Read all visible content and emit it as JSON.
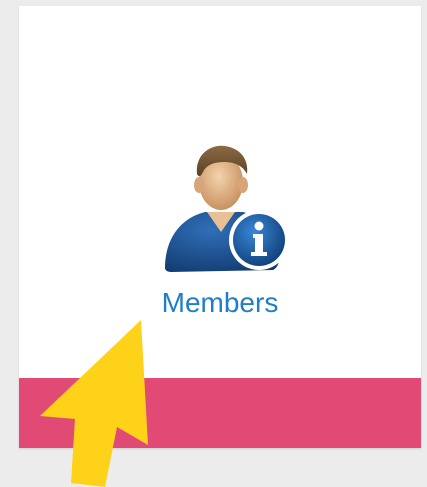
{
  "tile": {
    "label": "Members",
    "icon": "member-info-icon",
    "label_color": "#1f7ec9"
  },
  "bottom_bar": {
    "color": "#e04a74"
  },
  "pointer": {
    "icon": "arrow-icon",
    "color": "#ffd21a"
  }
}
